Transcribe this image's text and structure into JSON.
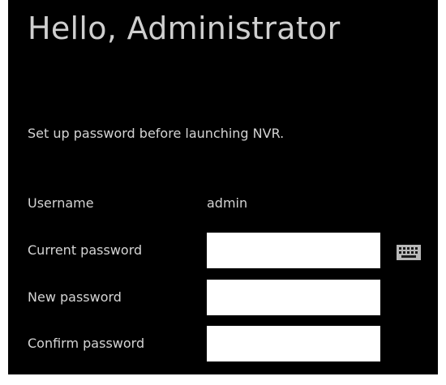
{
  "header": {
    "title": "Hello, Administrator"
  },
  "setup": {
    "instruction": "Set up password before launching NVR."
  },
  "form": {
    "username_label": "Username",
    "username_value": "admin",
    "current_password_label": "Current password",
    "current_password_value": "",
    "new_password_label": "New password",
    "new_password_value": "",
    "confirm_password_label": "Confirm password",
    "confirm_password_value": "",
    "keyboard_icon": "keyboard-icon"
  },
  "colors": {
    "background": "#000000",
    "text": "#d4d4d4",
    "input_background": "#ffffff"
  }
}
